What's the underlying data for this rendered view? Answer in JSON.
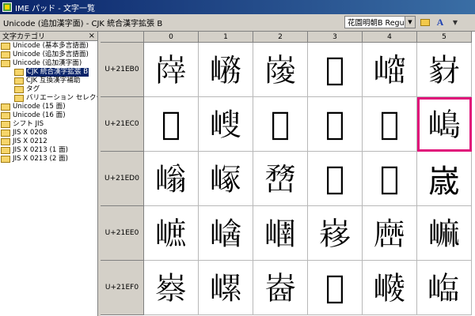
{
  "window": {
    "title": "IME パッド - 文字一覧"
  },
  "pathbar": {
    "path": "Unicode (追加漢字面) - CJK 統合漢字拡張 B"
  },
  "toolbar": {
    "font_value": "花園明朝B Regular",
    "buttons": [
      "folder-icon",
      "a-size-icon",
      "arrow-icon"
    ]
  },
  "sidebar": {
    "header": "文字カテゴリ",
    "close_glyph": "×",
    "items": [
      {
        "label": "Unicode (基本多言語面)",
        "level": 0,
        "selected": false
      },
      {
        "label": "Unicode (追加多言語面)",
        "level": 0,
        "selected": false
      },
      {
        "label": "Unicode (追加漢字面)",
        "level": 0,
        "selected": false
      },
      {
        "label": "CJK 統合漢字拡張 B",
        "level": 1,
        "selected": true
      },
      {
        "label": "CJK 互換漢字補助",
        "level": 1,
        "selected": false
      },
      {
        "label": "タグ",
        "level": 1,
        "selected": false
      },
      {
        "label": "バリエーション セレクター",
        "level": 1,
        "selected": false
      },
      {
        "label": "Unicode (15 面)",
        "level": 0,
        "selected": false
      },
      {
        "label": "Unicode (16 面)",
        "level": 0,
        "selected": false
      },
      {
        "label": "シフト JIS",
        "level": 0,
        "selected": false
      },
      {
        "label": "JIS X 0208",
        "level": 0,
        "selected": false
      },
      {
        "label": "JIS X 0212",
        "level": 0,
        "selected": false
      },
      {
        "label": "JIS X 0213 (1 面)",
        "level": 0,
        "selected": false
      },
      {
        "label": "JIS X 0213 (2 面)",
        "level": 0,
        "selected": false
      }
    ]
  },
  "grid": {
    "columns": [
      "0",
      "1",
      "2",
      "3",
      "4",
      "5"
    ],
    "rows": [
      {
        "label": "U+21EB0",
        "chars": [
          "𡺰",
          "𡺱",
          "𡺲",
          "𡺳",
          "𡺴",
          "𡺵"
        ]
      },
      {
        "label": "U+21EC0",
        "chars": [
          "𡻀",
          "𡻁",
          "𡻂",
          "𡻃",
          "𡻄",
          "𡻅"
        ]
      },
      {
        "label": "U+21ED0",
        "chars": [
          "𡻐",
          "𡻑",
          "𡻒",
          "𡻓",
          "𡻔",
          "𡻕"
        ]
      },
      {
        "label": "U+21EE0",
        "chars": [
          "𡻠",
          "𡻡",
          "𡻢",
          "𡻣",
          "𡻤",
          "𡻥"
        ]
      },
      {
        "label": "U+21EF0",
        "chars": [
          "𡻰",
          "𡻱",
          "𡻲",
          "𡻳",
          "𡻴",
          "𡻵"
        ]
      }
    ],
    "selected": {
      "row": 1,
      "col": 5
    }
  },
  "colors": {
    "title_bg": "#0a246a",
    "selection": "#0a246a",
    "cell_highlight": "#e0107a"
  }
}
